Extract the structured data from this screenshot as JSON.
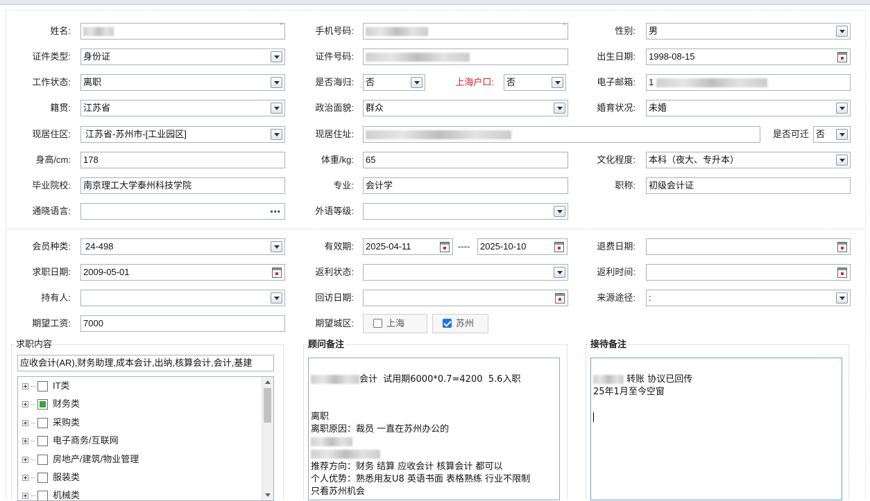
{
  "labels": {
    "name": "姓名:",
    "mobile": "手机号码:",
    "gender": "性别:",
    "id_type": "证件类型:",
    "id_no": "证件号码:",
    "birth": "出生日期:",
    "work_status": "工作状态:",
    "returnee": "是否海归:",
    "sh_hukou": "上海户口:",
    "email": "电子邮箱:",
    "native": "籍贯:",
    "political": "政治面貌:",
    "marital": "婚育状况:",
    "region": "现居住区:",
    "address": "现居住址:",
    "relocate": "是否可迁",
    "height": "身高/cm:",
    "weight": "体重/kg:",
    "education": "文化程度:",
    "school": "毕业院校:",
    "major": "专业:",
    "title": "职称:",
    "language": "通晓语言:",
    "foreign_level": "外语等级:",
    "member_type": "会员种类:",
    "valid": "有效期:",
    "refund_date": "退费日期:",
    "job_date": "求职日期:",
    "rebate_status": "返利状态:",
    "rebate_time": "返利时间:",
    "holder": "持有人:",
    "visit_date": "回访日期:",
    "source": "来源途径:",
    "salary": "期望工资:",
    "city": "期望城区:"
  },
  "values": {
    "name": "",
    "mobile": "",
    "gender": "男",
    "id_type": "身份证",
    "id_no": "",
    "birth": "1998-08-15",
    "work_status": "离职",
    "returnee": "否",
    "sh_hukou": "否",
    "email_prefix": "1",
    "native": "江苏省",
    "political": "群众",
    "marital": "未婚",
    "region": "江苏省-苏州市-[工业园区]",
    "relocate": "否",
    "height": "178",
    "weight": "65",
    "education": "本科（夜大、专升本）",
    "school": "南京理工大学泰州科技学院",
    "major": "会计学",
    "title": "初级会计证",
    "language_more": "•••",
    "member_type": "24-498",
    "valid_from": "2025-04-11",
    "valid_sep": "----",
    "valid_to": "2025-10-10",
    "job_date": "2009-05-01",
    "source": ":",
    "salary": "7000"
  },
  "required_mark": "*",
  "city_options": [
    {
      "label": "上海",
      "checked": false
    },
    {
      "label": "苏州",
      "checked": true
    }
  ],
  "job_panel": {
    "title": "求职内容",
    "summary": "应收会计(AR),财务助理,成本会计,出纳,核算会计,会计,基建",
    "tree": [
      {
        "label": "IT类",
        "state": "none"
      },
      {
        "label": "财务类",
        "state": "partial"
      },
      {
        "label": "采购类",
        "state": "none"
      },
      {
        "label": "电子商务/互联网",
        "state": "none"
      },
      {
        "label": "房地产/建筑/物业管理",
        "state": "none"
      },
      {
        "label": "服装类",
        "state": "none"
      },
      {
        "label": "机械类",
        "state": "none"
      }
    ]
  },
  "advisor_panel": {
    "title": "顾问备注",
    "line1_suffix": "会计  试用期6000*0.7=4200  5.6入职",
    "line_quit": "离职",
    "line_reason": "离职原因：裁员 一直在苏州办公的",
    "line_direction": "推荐方向：财务 结算 应收会计 核算会计 都可以",
    "line_advantage": "个人优势：熟悉用友U8 英语书面 表格熟练 行业不限制",
    "line_only": "只看苏州机会"
  },
  "reception_panel": {
    "title": "接待备注",
    "line1_suffix": " 转账 协议已回传",
    "line2": "25年1月至今空窗"
  },
  "colors": {
    "accent_red": "#d42020",
    "check_blue": "#1a73e8",
    "partial_green": "#3ca33c"
  }
}
